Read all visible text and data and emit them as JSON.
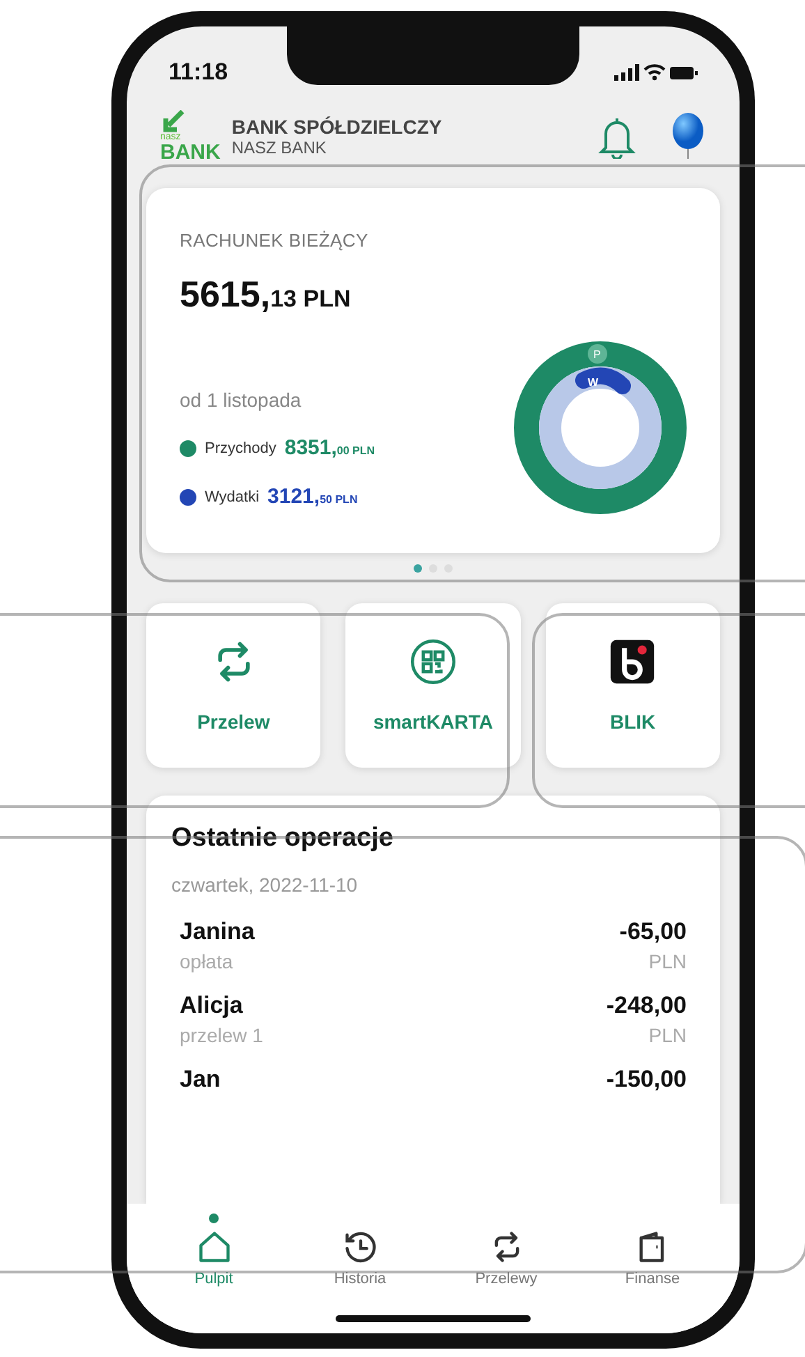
{
  "status_bar": {
    "time": "11:18"
  },
  "header": {
    "logo_small": "nasz",
    "logo_big": "BANK",
    "bank_name": "BANK SPÓŁDZIELCZY",
    "bank_subname": "NASZ BANK"
  },
  "account": {
    "title": "RACHUNEK BIEŻĄCY",
    "balance_main": "5615,",
    "balance_fraction": "13",
    "currency": "PLN",
    "period": "od 1 listopada",
    "legend": [
      {
        "label": "Przychody",
        "color": "#1e8a66",
        "main": "8351,",
        "fraction": "00",
        "currency": "PLN"
      },
      {
        "label": "Wydatki",
        "color": "#2346b5",
        "main": "3121,",
        "fraction": "50",
        "currency": "PLN"
      }
    ],
    "donut_labels": [
      "P",
      "W"
    ]
  },
  "carousel": [
    {
      "selected": true
    },
    {
      "selected": false
    },
    {
      "selected": false
    }
  ],
  "shortcuts": [
    {
      "kind": "transfer",
      "label": "Przelew"
    },
    {
      "kind": "qr",
      "label": "smartKARTA"
    },
    {
      "kind": "blik",
      "label": "BLIK"
    }
  ],
  "operations": {
    "title": "Ostatnie operacje",
    "date": "czwartek, 2022-11-10",
    "items": [
      {
        "name": "Janina",
        "desc": "opłata",
        "amount": "-65,00",
        "currency": "PLN"
      },
      {
        "name": "Alicja",
        "desc": "przelew 1",
        "amount": "-248,00",
        "currency": "PLN"
      },
      {
        "name": "Jan",
        "amount": "-150,00"
      }
    ]
  },
  "nav": [
    {
      "kind": "home",
      "label": "Pulpit",
      "selected": true
    },
    {
      "kind": "history",
      "label": "Historia",
      "selected": false
    },
    {
      "kind": "transfer",
      "label": "Przelewy",
      "selected": false
    },
    {
      "kind": "wallet",
      "label": "Finanse",
      "selected": false
    }
  ]
}
